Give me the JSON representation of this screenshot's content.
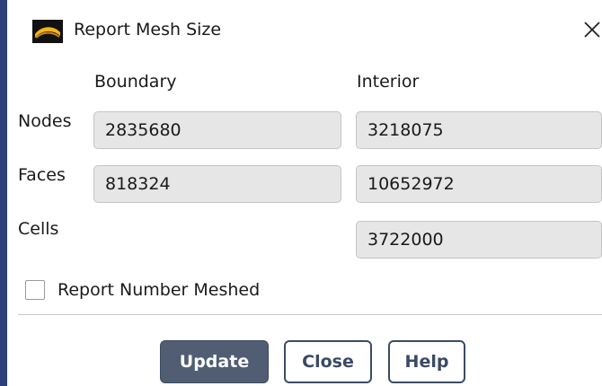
{
  "window": {
    "title": "Report Mesh Size",
    "icon": "ansys-logo-icon",
    "close_icon": "close-icon"
  },
  "columns": {
    "boundary": "Boundary",
    "interior": "Interior"
  },
  "rows": {
    "nodes": {
      "label": "Nodes",
      "boundary": "2835680",
      "interior": "3218075"
    },
    "faces": {
      "label": "Faces",
      "boundary": "818324",
      "interior": "10652972"
    },
    "cells": {
      "label": "Cells",
      "interior": "3722000"
    }
  },
  "options": {
    "report_number_meshed": {
      "label": "Report Number Meshed",
      "checked": false
    }
  },
  "buttons": {
    "update": "Update",
    "close": "Close",
    "help": "Help"
  },
  "colors": {
    "primary_button": "#505d73",
    "secondary_border": "#3c4b66",
    "field_bg": "#e6e6e6",
    "window_edge": "#2f3f7a"
  }
}
